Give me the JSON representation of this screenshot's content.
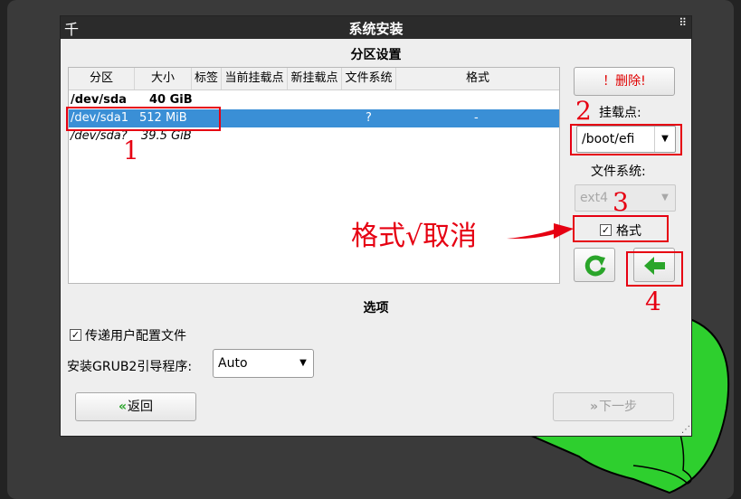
{
  "window": {
    "title": "系统安装",
    "menu_icon": "千",
    "dots_icon": "⠿"
  },
  "partition": {
    "section_title": "分区设置",
    "columns": [
      "分区",
      "大小",
      "标签",
      "当前挂载点",
      "新挂载点",
      "文件系统",
      "格式"
    ],
    "rows": [
      {
        "name": "/dev/sda",
        "size": "40 GiB",
        "filesystem": "",
        "format": ""
      },
      {
        "name": "/dev/sda1",
        "size": "512 MiB",
        "filesystem": "?",
        "format": "-"
      },
      {
        "name": "/dev/sda?",
        "size": "39.5 GiB",
        "filesystem": "",
        "format": ""
      }
    ],
    "delete_label": "！删除!",
    "mount_label": "挂载点:",
    "mount_value": "/boot/efi",
    "fs_label": "文件系统:",
    "fs_value": "ext4",
    "format_label": "格式",
    "format_checked": "✓"
  },
  "options": {
    "section_title": "选项",
    "pass_user_config_label": "传递用户配置文件",
    "pass_user_config_checked": "✓",
    "grub_label": "安装GRUB2引导程序:",
    "grub_value": "Auto"
  },
  "footer": {
    "back_chev": "«",
    "back_label": "返回",
    "next_chev": "»",
    "next_label": "下一步"
  },
  "annotations": {
    "n1": "1",
    "n2": "2",
    "n3": "3",
    "n4": "4",
    "note": "格式√取消"
  },
  "colors": {
    "accent_selected": "#3a8fd6",
    "annotation_red": "#e60012",
    "green_icon": "#2aa52a"
  }
}
